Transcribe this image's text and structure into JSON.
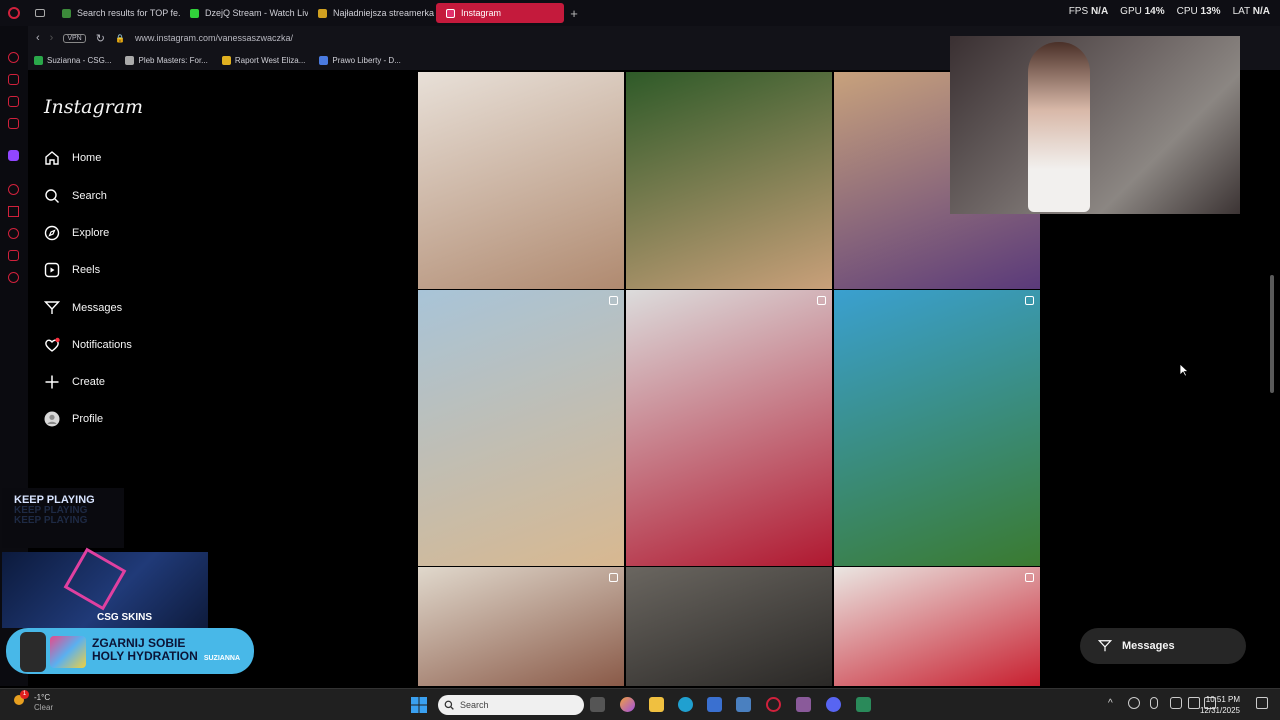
{
  "browser": {
    "tabs": [
      {
        "label": "Search results for TOP fe...",
        "color": "#3c8a3a"
      },
      {
        "label": "DzejQ Stream - Watch Liv...",
        "color": "#31d13a"
      },
      {
        "label": "Najładniejsza streamerka ...",
        "color": "#d0a020"
      },
      {
        "label": "Instagram",
        "color": "#e1306c"
      }
    ],
    "stats": {
      "fps_label": "FPS",
      "fps": "N/A",
      "gpu_label": "GPU",
      "gpu": "14%",
      "cpu_label": "CPU",
      "cpu": "13%",
      "lat_label": "LAT",
      "lat": "N/A"
    },
    "vpn": "VPN",
    "url": "www.instagram.com/vanessaszwaczka/",
    "bookmarks": [
      {
        "label": "Suzianna - CSG...",
        "color": "#2aa84a"
      },
      {
        "label": "Pleb Masters: For...",
        "color": "#aaaaaa"
      },
      {
        "label": "Raport West Eliza...",
        "color": "#e0b020"
      },
      {
        "label": "Prawo Liberty - D...",
        "color": "#4a7adf"
      }
    ]
  },
  "instagram": {
    "logo": "Instagram",
    "nav": [
      {
        "label": "Home",
        "icon": "home-icon"
      },
      {
        "label": "Search",
        "icon": "search-icon"
      },
      {
        "label": "Explore",
        "icon": "compass-icon"
      },
      {
        "label": "Reels",
        "icon": "reels-icon"
      },
      {
        "label": "Messages",
        "icon": "messages-icon"
      },
      {
        "label": "Notifications",
        "icon": "heart-icon"
      },
      {
        "label": "Create",
        "icon": "plus-icon"
      },
      {
        "label": "Profile",
        "icon": "avatar-icon"
      }
    ],
    "messages_button": "Messages",
    "posts": [
      {
        "colors": [
          "#e8e0d8",
          "#b08a70"
        ],
        "multi": false
      },
      {
        "colors": [
          "#2e5a28",
          "#c9a07a"
        ],
        "multi": false
      },
      {
        "colors": [
          "#c8a27c",
          "#5a3a7a"
        ],
        "multi": false
      },
      {
        "colors": [
          "#a8c4d8",
          "#d8b890"
        ],
        "multi": true
      },
      {
        "colors": [
          "#dcdcdc",
          "#b01830"
        ],
        "multi": true
      },
      {
        "colors": [
          "#3aa0d0",
          "#3a7a30"
        ],
        "multi": true
      },
      {
        "colors": [
          "#e0d8cc",
          "#8a5a48"
        ],
        "multi": true
      },
      {
        "colors": [
          "#6a6660",
          "#2a2826"
        ],
        "multi": false
      },
      {
        "colors": [
          "#eae6e2",
          "#c82030"
        ],
        "multi": true
      }
    ]
  },
  "overlays": {
    "keep_playing": "KEEP PLAYING",
    "csg_skins": "CSG SKINS",
    "hydration_line1": "ZGARNIJ SOBIE",
    "hydration_line2": "HOLY HYDRATION",
    "hydration_brand": "SUZIANNA"
  },
  "taskbar": {
    "weather_temp": "-1°C",
    "weather_desc": "Clear",
    "weather_badge": "1",
    "search_placeholder": "Search",
    "time": "10:51 PM",
    "date": "12/31/2025"
  }
}
